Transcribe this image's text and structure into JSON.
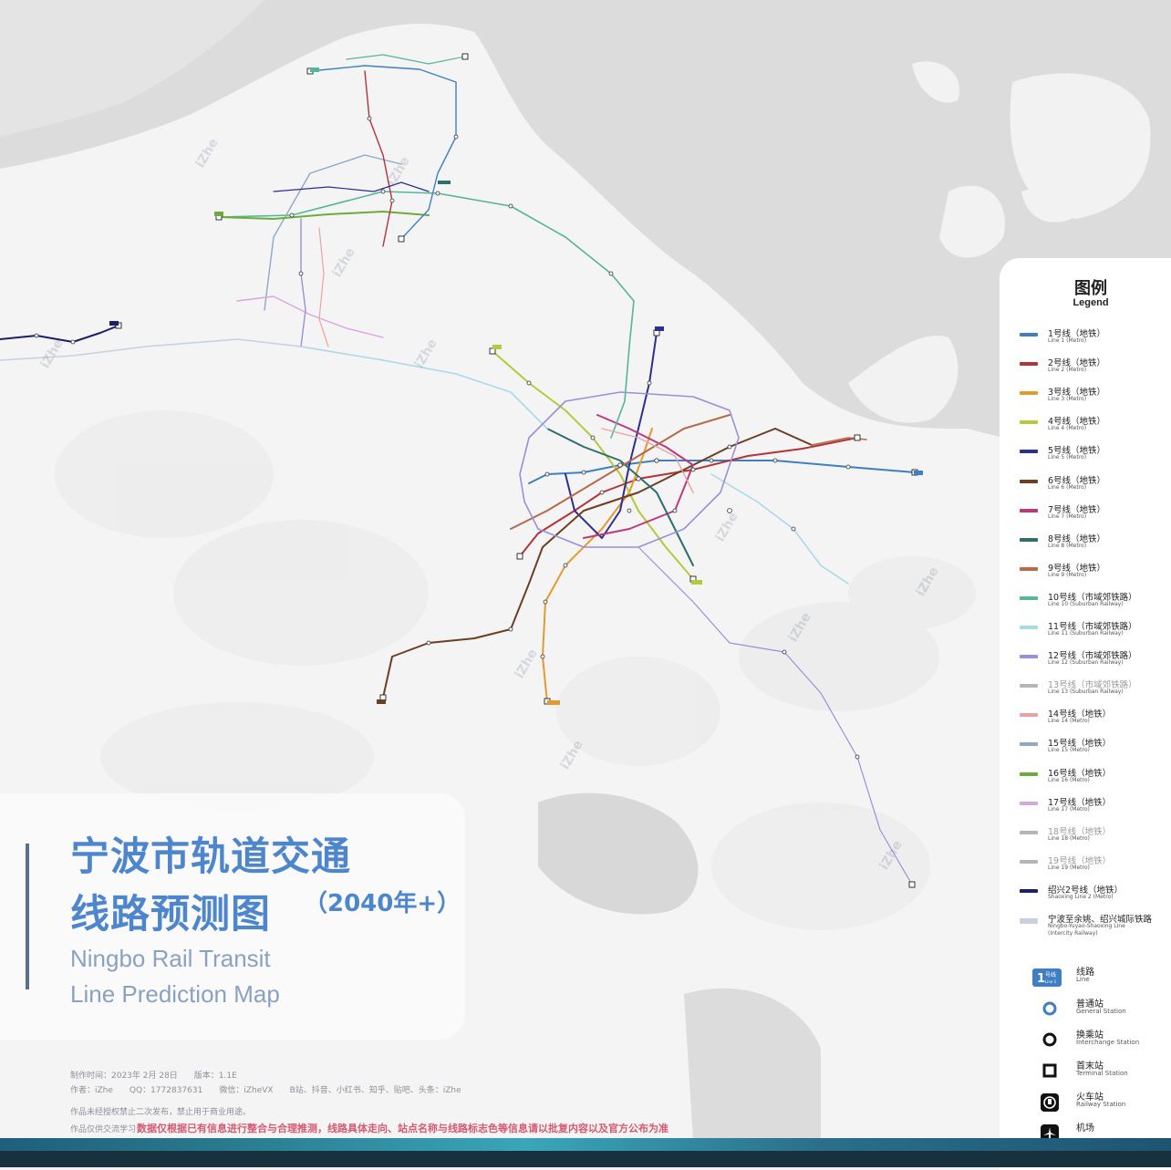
{
  "title": {
    "zh_line1": "宁波市轨道交通",
    "zh_line2": "线路预测图",
    "year": "（2040年+）",
    "en_line1": "Ningbo Rail Transit",
    "en_line2": "Line Prediction Map"
  },
  "meta": {
    "line1": "制作时间：2023年 2月 28日　　版本：1.1E",
    "line2": "作者：iZhe　　QQ：1772837631　　微信：iZheVX　　B站、抖音、小红书、知乎、贴吧、头条：iZhe",
    "line3": "作品未经授权禁止二次发布，禁止用于商业用途。",
    "line4_prefix": "作品仅供交流学习，",
    "notice": "数据仅根据已有信息进行整合与合理推测，线路具体走向、站点名称与线路标志色等信息请以批复内容以及官方公布为准"
  },
  "legend": {
    "title": "图例",
    "subtitle": "Legend",
    "lines": [
      {
        "zh": "1号线（地铁）",
        "en": "Line 1 (Metro)",
        "color": "#3f7fc1"
      },
      {
        "zh": "2号线（地铁）",
        "en": "Line 2 (Metro)",
        "color": "#b0353a"
      },
      {
        "zh": "3号线（地铁）",
        "en": "Line 3 (Metro)",
        "color": "#e39a2e"
      },
      {
        "zh": "4号线（地铁）",
        "en": "Line 4 (Metro)",
        "color": "#b6c93a"
      },
      {
        "zh": "5号线（地铁）",
        "en": "Line 5 (Metro)",
        "color": "#2c2f8f"
      },
      {
        "zh": "6号线（地铁）",
        "en": "Line 6 (Metro)",
        "color": "#6b3f22"
      },
      {
        "zh": "7号线（地铁）",
        "en": "Line 7 (Metro)",
        "color": "#b83a7f"
      },
      {
        "zh": "8号线（地铁）",
        "en": "Line 8 (Metro)",
        "color": "#2e6e6e"
      },
      {
        "zh": "9号线（地铁）",
        "en": "Line 9 (Metro)",
        "color": "#b56a4a"
      },
      {
        "zh": "10号线（市域郊铁路）",
        "en": "Line 10 (Suburban Railway)",
        "color": "#55b59a"
      },
      {
        "zh": "11号线（市域郊铁路）",
        "en": "Line 11 (Suburban Railway)",
        "color": "#a9d9e8"
      },
      {
        "zh": "12号线（市域郊铁路）",
        "en": "Line 12 (Suburban Railway)",
        "color": "#9b8fd8"
      },
      {
        "zh": "13号线（市域郊铁路）",
        "en": "Line 13 (Suburban Railway)",
        "color": "#b5b5b5"
      },
      {
        "zh": "14号线（地铁）",
        "en": "Line 14 (Metro)",
        "color": "#e8a3a3"
      },
      {
        "zh": "15号线（地铁）",
        "en": "Line 15 (Metro)",
        "color": "#8ea9c7"
      },
      {
        "zh": "16号线（地铁）",
        "en": "Line 16 (Metro)",
        "color": "#6cab3c"
      },
      {
        "zh": "17号线（地铁）",
        "en": "Line 17 (Metro)",
        "color": "#d9a6dc"
      },
      {
        "zh": "18号线（地铁）",
        "en": "Line 18 (Metro)",
        "color": "#b5b5b5"
      },
      {
        "zh": "19号线（地铁）",
        "en": "Line 19 (Metro)",
        "color": "#b5b5b5"
      },
      {
        "zh": "绍兴2号线（地铁）",
        "en": "Shaoxing Line 2 (Metro)",
        "color": "#1d1f6b"
      },
      {
        "zh": "宁波至余姚、绍兴城际铁路",
        "en": "Ningbo-Yuyao-Shaoxing Line",
        "en2": "(Intercity Railway)",
        "color": "#c8d0e0"
      }
    ],
    "symbols": [
      {
        "zh": "线路",
        "en": "Line",
        "icon": "line-badge-icon"
      },
      {
        "zh": "普通站",
        "en": "General Station",
        "icon": "general-station-icon"
      },
      {
        "zh": "换乘站",
        "en": "Interchange Station",
        "icon": "interchange-station-icon"
      },
      {
        "zh": "首末站",
        "en": "Terminal Station",
        "icon": "terminal-station-icon"
      },
      {
        "zh": "火车站",
        "en": "Railway Station",
        "icon": "railway-station-icon"
      },
      {
        "zh": "机场",
        "en": "",
        "icon": "airport-icon"
      }
    ],
    "badge_text": "号线",
    "badge_num": "1",
    "badge_en": "Line 1"
  },
  "watermark": "iZhe"
}
